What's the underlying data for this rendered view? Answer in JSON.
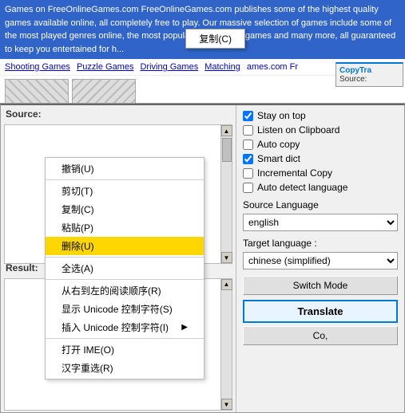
{
  "browser": {
    "highlighted_text": "Games on FreeOnlineGames.com FreeOnlineGames.com publishes some of the highest quality games available online, all completely free to play. Our massive selection of games include some of the most played genres online, the most popular being racing games and many more, all guaranteed to keep you entertained for h...",
    "links": [
      "Shooting Games",
      "Puzzle Games",
      "Driving Games",
      "Matching"
    ],
    "partial_text": "ames.com Fr"
  },
  "context_menu_small": {
    "item": "复制(C)"
  },
  "copytrans": {
    "title": "CopyTra",
    "source_label": "Source:"
  },
  "context_menu": {
    "items": [
      {
        "label": "撤销(U)",
        "shortcut": "",
        "has_arrow": false,
        "highlighted": false
      },
      {
        "label": "剪切(T)",
        "shortcut": "",
        "has_arrow": false,
        "highlighted": false
      },
      {
        "label": "复制(C)",
        "shortcut": "",
        "has_arrow": false,
        "highlighted": false
      },
      {
        "label": "粘贴(P)",
        "shortcut": "",
        "has_arrow": false,
        "highlighted": false
      },
      {
        "label": "删除(U)",
        "shortcut": "",
        "has_arrow": false,
        "highlighted": true
      },
      {
        "label": "全选(A)",
        "shortcut": "",
        "has_arrow": false,
        "highlighted": false
      },
      {
        "label": "从右到左的阅读顺序(R)",
        "shortcut": "",
        "has_arrow": false,
        "highlighted": false
      },
      {
        "label": "显示 Unicode 控制字符(S)",
        "shortcut": "",
        "has_arrow": false,
        "highlighted": false
      },
      {
        "label": "插入 Unicode 控制字符(I)",
        "shortcut": "",
        "has_arrow": true,
        "highlighted": false
      },
      {
        "label": "打开 IME(O)",
        "shortcut": "",
        "has_arrow": false,
        "highlighted": false
      },
      {
        "label": "汉字重选(R)",
        "shortcut": "",
        "has_arrow": false,
        "highlighted": false
      }
    ]
  },
  "translator": {
    "source_label": "Source:",
    "result_label": "Result:",
    "checkboxes": [
      {
        "label": "Stay on top",
        "checked": true
      },
      {
        "label": "Listen on Clipboard",
        "checked": false
      },
      {
        "label": "Auto copy",
        "checked": false
      },
      {
        "label": "Smart dict",
        "checked": true
      },
      {
        "label": "Incremental Copy",
        "checked": false
      },
      {
        "label": "Auto detect language",
        "checked": false
      }
    ],
    "source_language_label": "Source Language",
    "source_language_value": "english",
    "target_language_label": "Target language :",
    "target_language_value": "chinese (simplified)",
    "switch_mode_label": "Switch Mode",
    "translate_label": "Translate",
    "copy_label": "Co,"
  }
}
